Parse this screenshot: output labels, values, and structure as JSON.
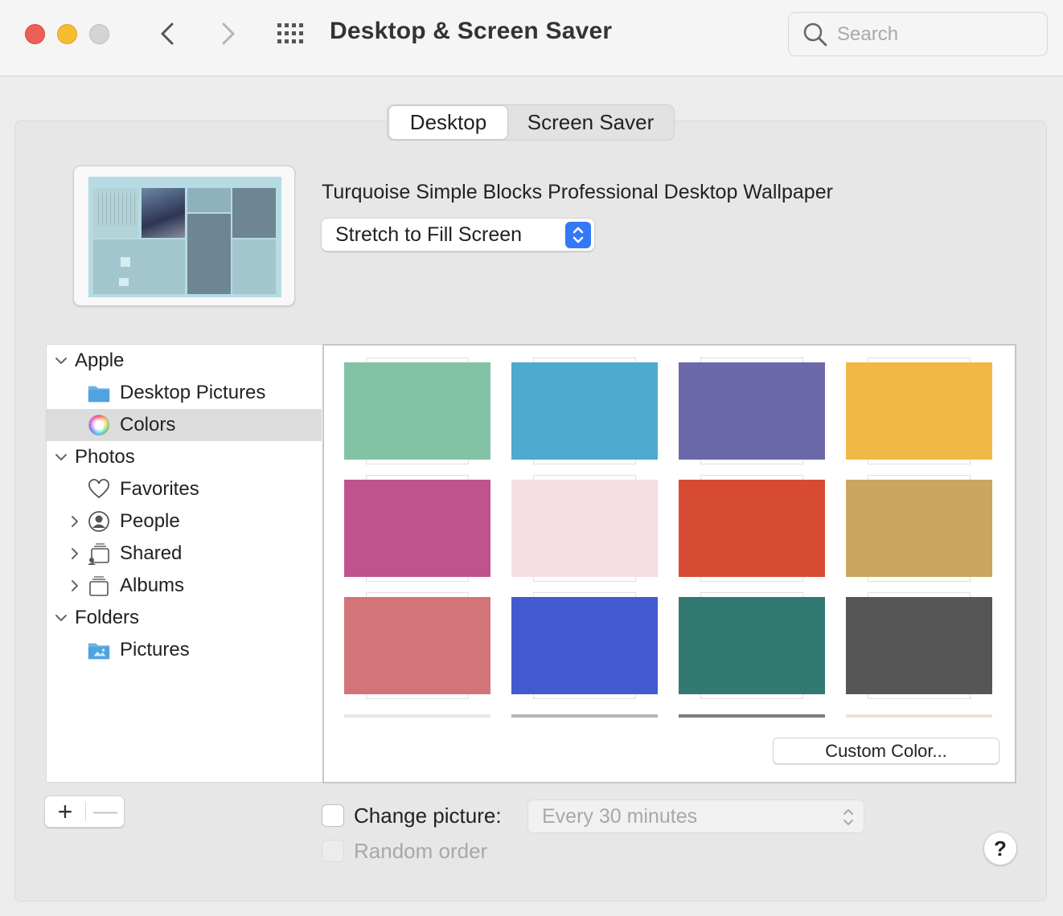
{
  "window": {
    "title": "Desktop & Screen Saver"
  },
  "search": {
    "placeholder": "Search"
  },
  "tabs": [
    {
      "label": "Desktop",
      "active": true
    },
    {
      "label": "Screen Saver",
      "active": false
    }
  ],
  "wallpaper": {
    "name": "Turquoise Simple Blocks Professional Desktop Wallpaper"
  },
  "fit_mode": {
    "selected": "Stretch to Fill Screen"
  },
  "sidebar": {
    "sections": [
      {
        "label": "Apple",
        "items": [
          {
            "label": "Desktop Pictures",
            "icon": "folder-icon"
          },
          {
            "label": "Colors",
            "icon": "color-wheel-icon",
            "selected": true
          }
        ]
      },
      {
        "label": "Photos",
        "items": [
          {
            "label": "Favorites",
            "icon": "heart-icon"
          },
          {
            "label": "People",
            "icon": "person-icon"
          },
          {
            "label": "Shared",
            "icon": "shared-albums-icon"
          },
          {
            "label": "Albums",
            "icon": "albums-icon"
          }
        ]
      },
      {
        "label": "Folders",
        "items": [
          {
            "label": "Pictures",
            "icon": "pictures-folder-icon"
          }
        ]
      }
    ]
  },
  "colors": [
    "#82c3a5",
    "#4eaace",
    "#6b69aa",
    "#f2b844",
    "#be538f",
    "#f5dde3",
    "#d84b33",
    "#cba660",
    "#d37479",
    "#4359cf",
    "#327971",
    "#565656"
  ],
  "colors_partial_row": [
    "#e6e6e6",
    "#b4b4b4",
    "#7a7a7f",
    "#f0e2d1"
  ],
  "custom_color": {
    "label": "Custom Color..."
  },
  "list_controls": {
    "add": "+",
    "remove": "—"
  },
  "change_picture": {
    "label": "Change picture:",
    "checked": false,
    "interval": "Every 30 minutes"
  },
  "random_order": {
    "label": "Random order",
    "checked": false,
    "enabled": false
  },
  "help": {
    "label": "?"
  }
}
